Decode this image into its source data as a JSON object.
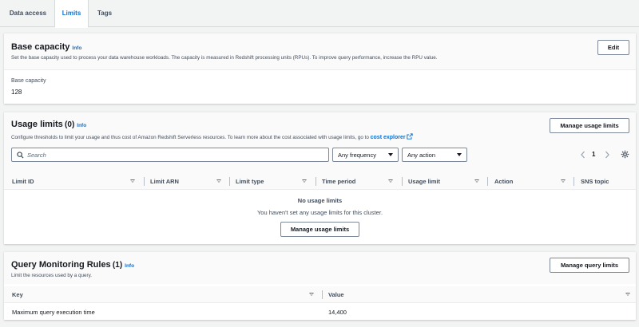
{
  "tabs": [
    {
      "label": "Data access"
    },
    {
      "label": "Limits"
    },
    {
      "label": "Tags"
    }
  ],
  "base_capacity": {
    "title": "Base capacity",
    "info": "Info",
    "description": "Set the base capacity used to process your data warehouse workloads. The capacity is measured in Redshift processing units (RPUs). To improve query performance, increase the RPU value.",
    "edit_label": "Edit",
    "field_label": "Base capacity",
    "field_value": "128"
  },
  "usage_limits": {
    "title": "Usage limits",
    "count": "(0)",
    "info": "Info",
    "description": "Configure thresholds to limit your usage and thus cost of Amazon Redshift Serverless resources. To learn more about the cost associated with usage limits, go to",
    "link_text": "cost explorer",
    "manage_label": "Manage usage limits",
    "search_placeholder": "Search",
    "frequency_value": "Any frequency",
    "action_value": "Any action",
    "page_number": "1",
    "columns": [
      "Limit ID",
      "Limit ARN",
      "Limit type",
      "Time period",
      "Usage limit",
      "Action",
      "SNS topic"
    ],
    "empty_title": "No usage limits",
    "empty_message": "You haven't set any usage limits for this cluster.",
    "empty_button": "Manage usage limits"
  },
  "qmr": {
    "title": "Query Monitoring Rules",
    "count": "(1)",
    "info": "Info",
    "description": "Limit the resources used by a query.",
    "manage_label": "Manage query limits",
    "columns": [
      "Key",
      "Value"
    ],
    "rows": [
      {
        "key": "Maximum query execution time",
        "value": "14,400"
      }
    ]
  },
  "colors": {
    "accent": "#0972d3",
    "text": "#16191f",
    "background": "#f2f3f3"
  }
}
